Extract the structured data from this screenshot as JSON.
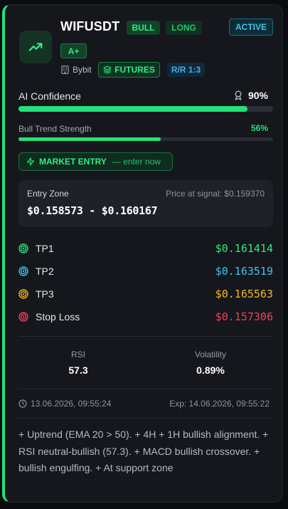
{
  "signal": {
    "symbol": "WIFUSDT",
    "bias_badge": "BULL",
    "direction_badge": "LONG",
    "status_badge": "ACTIVE",
    "grade_badge": "A+",
    "exchange": "Bybit",
    "market_badge": "FUTURES",
    "rr_badge": "R/R 1:3"
  },
  "confidence": {
    "label": "AI Confidence",
    "value_text": "90%",
    "value_fraction": 0.9
  },
  "trend": {
    "label": "Bull Trend Strength",
    "value_text": "56%",
    "value_fraction": 0.56
  },
  "entry_button": {
    "label": "MARKET ENTRY",
    "sublabel": "— enter now"
  },
  "entry_zone": {
    "label": "Entry Zone",
    "price_at_signal": "Price at signal: $0.159370",
    "range": "$0.158573 - $0.160167"
  },
  "targets": [
    {
      "name": "TP1",
      "price": "$0.161414",
      "color": "#2ee87e"
    },
    {
      "name": "TP2",
      "price": "$0.163519",
      "color": "#3bc8ef"
    },
    {
      "name": "TP3",
      "price": "$0.165563",
      "color": "#f5b91c"
    },
    {
      "name": "Stop Loss",
      "price": "$0.157306",
      "color": "#f0405b"
    }
  ],
  "stats": {
    "rsi_label": "RSI",
    "rsi_value": "57.3",
    "volatility_label": "Volatility",
    "volatility_value": "0.89%"
  },
  "timestamps": {
    "created": "13.06.2026, 09:55:24",
    "expiry": "Exp: 14.06.2026, 09:55:22"
  },
  "notes": "+ Uptrend (EMA 20 > 50). + 4H + 1H bullish alignment. + RSI neutral-bullish (57.3). + MACD bullish crossover. + bullish engulfing. + At support zone",
  "icons": {
    "logo": "trending-up-icon",
    "exchange": "building-icon",
    "futures": "layers-icon",
    "confidence": "award-icon",
    "entry": "zap-icon",
    "targets": "target-icon",
    "created": "clock-icon"
  },
  "colors": {
    "accent": "#23e27a",
    "info": "#3bc8ef",
    "warning": "#f5b91c",
    "danger": "#f0405b"
  }
}
